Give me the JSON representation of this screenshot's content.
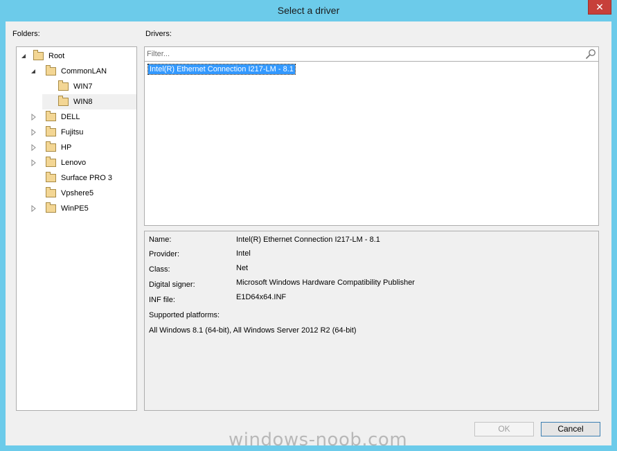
{
  "window": {
    "title": "Select a driver",
    "close_glyph": "✕"
  },
  "folders": {
    "label": "Folders:",
    "tree": [
      {
        "label": "Root",
        "icon": "folder-icon",
        "expanded": true
      },
      {
        "label": "CommonLAN",
        "icon": "folder-icon",
        "expanded": true
      },
      {
        "label": "WIN7",
        "icon": "folder-icon"
      },
      {
        "label": "WIN8",
        "icon": "folder-icon",
        "selected": true
      },
      {
        "label": "DELL",
        "icon": "folder-icon",
        "expanded": false
      },
      {
        "label": "Fujitsu",
        "icon": "folder-icon",
        "expanded": false
      },
      {
        "label": "HP",
        "icon": "folder-icon",
        "expanded": false
      },
      {
        "label": "Lenovo",
        "icon": "folder-icon",
        "expanded": false
      },
      {
        "label": "Surface PRO 3",
        "icon": "folder-icon"
      },
      {
        "label": "Vpshere5",
        "icon": "folder-icon"
      },
      {
        "label": "WinPE5",
        "icon": "folder-icon",
        "expanded": false
      }
    ]
  },
  "drivers": {
    "label": "Drivers:",
    "filter_placeholder": "Filter...",
    "filter_value": "",
    "items": [
      {
        "label": "Intel(R) Ethernet Connection I217-LM - 8.1",
        "selected": true
      }
    ]
  },
  "details": {
    "name_label": "Name:",
    "name_value": "Intel(R) Ethernet Connection I217-LM - 8.1",
    "provider_label": "Provider:",
    "provider_value": "Intel",
    "class_label": "Class:",
    "class_value": "Net",
    "signer_label": "Digital signer:",
    "signer_value": "Microsoft Windows Hardware Compatibility Publisher",
    "inf_label": "INF file:",
    "inf_value": "E1D64x64.INF",
    "platforms_label": "Supported platforms:",
    "platforms_value": "All Windows 8.1 (64-bit), All Windows Server 2012 R2 (64-bit)"
  },
  "buttons": {
    "ok": "OK",
    "cancel": "Cancel"
  },
  "watermark": "windows-noob.com",
  "colors": {
    "frame": "#6ccbea",
    "close": "#c7403a",
    "selection": "#3399ff",
    "client": "#f0f0f0"
  }
}
